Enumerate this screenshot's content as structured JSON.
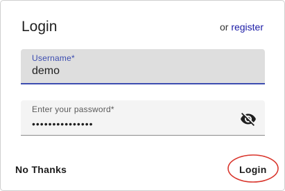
{
  "dialog": {
    "title": "Login",
    "register_prefix": "or",
    "register_link": "register"
  },
  "fields": {
    "username": {
      "label": "Username*",
      "value": "demo"
    },
    "password": {
      "label": "Enter your password*",
      "value": "•••••••••••••••",
      "toggle_icon": "eye-slash-icon"
    }
  },
  "actions": {
    "no_thanks_label": "No Thanks",
    "login_label": "Login"
  },
  "colors": {
    "accent": "#3b4cb0",
    "link": "#1a1aa6",
    "highlight_ring": "#d9342b"
  }
}
